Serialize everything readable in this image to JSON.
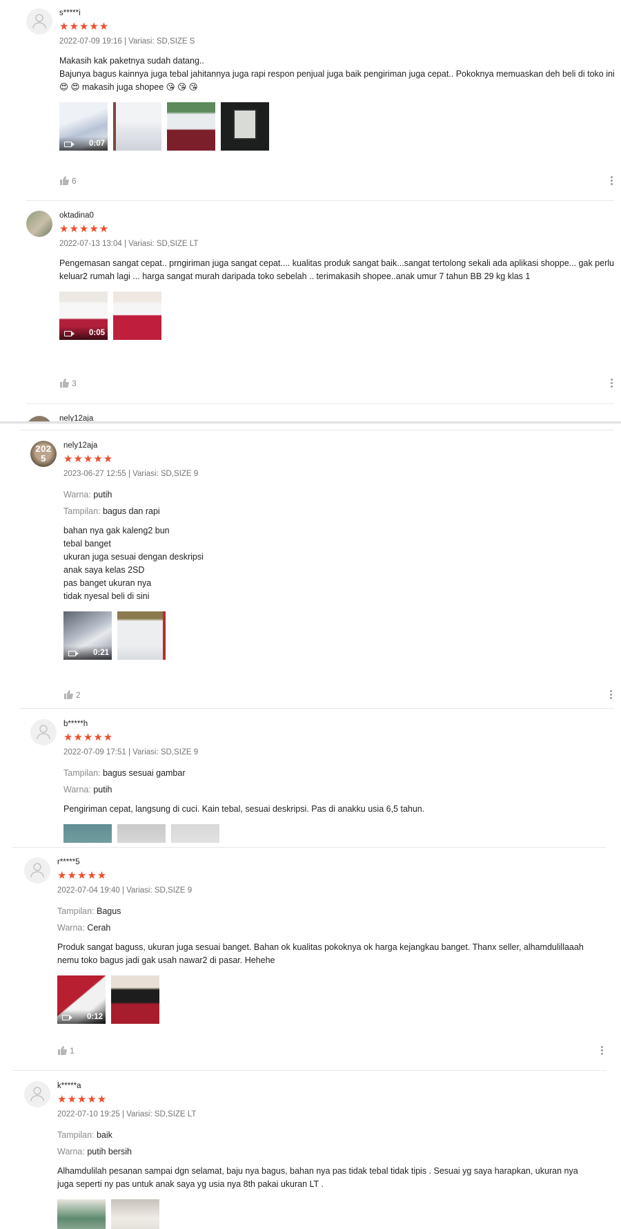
{
  "reviews": [
    {
      "username": "s*****i",
      "stars": "★★★★★",
      "meta": "2022-07-09 19:16 | Variasi: SD,SIZE S",
      "text": "Makasih kak paketnya sudah datang..\nBajunya bagus kainnya juga tebal jahitannya juga rapi respon penjual juga baik pengiriman juga cepat.. Pokoknya memuaskan deh beli di toko ini 😍 😍 makasih juga shopee 😘 😘 😘",
      "video_duration": "0:07",
      "likes": "6"
    },
    {
      "username": "oktadina0",
      "stars": "★★★★★",
      "meta": "2022-07-13 13:04 | Variasi: SD,SIZE LT",
      "text": "Pengemasan sangat cepat.. prngiriman juga sangat cepat.... kualitas produk sangat baik...sangat tertolong sekali ada aplikasi shoppe... gak perlu keluar2 rumah lagi ... harga sangat murah daripada toko sebelah .. terimakasih shopee..anak umur 7 tahun BB 29 kg klas 1",
      "video_duration": "0:05",
      "likes": "3"
    },
    {
      "username": "nely12aja",
      "avatar_text": "2025",
      "stars": "★★★★★",
      "meta": "2023-06-27 12:55 | Variasi: SD,SIZE 9",
      "attrs": [
        {
          "key": "Warna:",
          "value": "putih"
        },
        {
          "key": "Tampilan:",
          "value": "bagus dan rapi"
        }
      ],
      "text": "bahan nya gak kaleng2 bun\ntebal banget\nukuran juga sesuai dengan deskripsi\nanak saya kelas 2SD\npas banget ukuran nya\ntidak nyesal beli di sini",
      "video_duration": "0:21",
      "likes": "2"
    },
    {
      "username": "b*****h",
      "stars": "★★★★★",
      "meta": "2022-07-09 17:51 | Variasi: SD,SIZE 9",
      "attrs": [
        {
          "key": "Tampilan:",
          "value": "bagus sesuai gambar"
        },
        {
          "key": "Warna:",
          "value": "putih"
        }
      ],
      "text": "Pengiriman cepat, langsung di cuci. Kain tebal, sesuai deskripsi. Pas di anakku usia 6,5 tahun."
    },
    {
      "username": "r*****5",
      "stars": "★★★★★",
      "meta": "2022-07-04 19:40 | Variasi: SD,SIZE 9",
      "attrs": [
        {
          "key": "Tampilan:",
          "value": "Bagus"
        },
        {
          "key": "Warna:",
          "value": "Cerah"
        }
      ],
      "text": "Produk sangat baguss, ukuran juga sesuai banget. Bahan ok kualitas pokoknya ok harga kejangkau banget. Thanx seller, alhamdulillaaah nemu toko bagus jadi gak usah nawar2 di pasar. Hehehe",
      "video_duration": "0:12",
      "likes": "1"
    },
    {
      "username": "k*****a",
      "stars": "★★★★★",
      "meta": "2022-07-10 19:25 | Variasi: SD,SIZE LT",
      "attrs": [
        {
          "key": "Tampilan:",
          "value": "baik"
        },
        {
          "key": "Warna:",
          "value": "putih bersih"
        }
      ],
      "text": "Alhamdulilah pesanan sampai dgn selamat, baju nya bagus, bahan nya pas tidak tebal tidak tipis . Sesuai yg saya harapkan, ukuran nya juga seperti ny pas untuk anak saya yg usia nya 8th pakai ukuran LT ."
    }
  ],
  "peek_username": "nely12aja",
  "colors": {
    "star": "#ee4d2d",
    "muted": "#757575",
    "divider": "#e8e8e8"
  }
}
